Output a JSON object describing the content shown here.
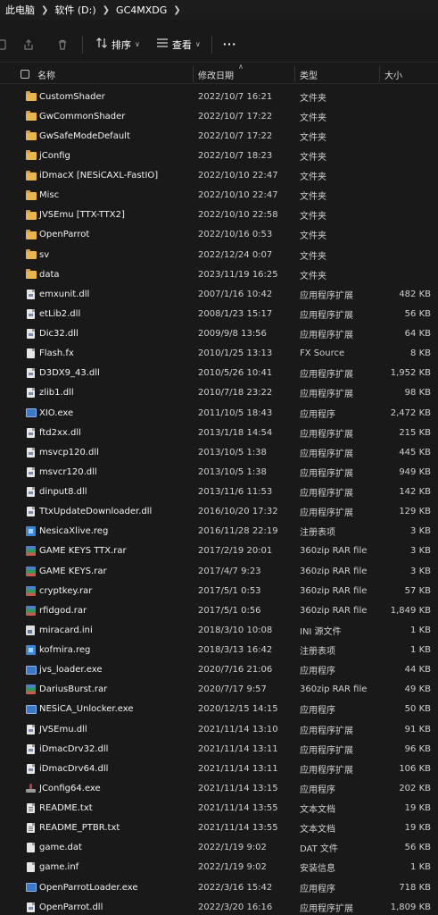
{
  "breadcrumb": [
    "此电脑",
    "软件 (D:)",
    "GC4MXDG"
  ],
  "toolbar": {
    "sort_label": "排序",
    "view_label": "查看",
    "more_label": "···"
  },
  "columns": {
    "name": "名称",
    "date": "修改日期",
    "type": "类型",
    "size": "大小"
  },
  "files": [
    {
      "icon": "folder",
      "name": "CustomShader",
      "date": "2022/10/7 16:21",
      "type": "文件夹",
      "size": ""
    },
    {
      "icon": "folder",
      "name": "GwCommonShader",
      "date": "2022/10/7 17:22",
      "type": "文件夹",
      "size": ""
    },
    {
      "icon": "folder",
      "name": "GwSafeModeDefault",
      "date": "2022/10/7 17:22",
      "type": "文件夹",
      "size": ""
    },
    {
      "icon": "folder",
      "name": "jConfig",
      "date": "2022/10/7 18:23",
      "type": "文件夹",
      "size": ""
    },
    {
      "icon": "folder",
      "name": "iDmacX [NESiCAXL-FastIO]",
      "date": "2022/10/10 22:47",
      "type": "文件夹",
      "size": ""
    },
    {
      "icon": "folder",
      "name": "Misc",
      "date": "2022/10/10 22:47",
      "type": "文件夹",
      "size": ""
    },
    {
      "icon": "folder",
      "name": "JVSEmu [TTX-TTX2]",
      "date": "2022/10/10 22:58",
      "type": "文件夹",
      "size": ""
    },
    {
      "icon": "folder",
      "name": "OpenParrot",
      "date": "2022/10/16 0:53",
      "type": "文件夹",
      "size": ""
    },
    {
      "icon": "folder",
      "name": "sv",
      "date": "2022/12/24 0:07",
      "type": "文件夹",
      "size": ""
    },
    {
      "icon": "folder",
      "name": "data",
      "date": "2023/11/19 16:25",
      "type": "文件夹",
      "size": ""
    },
    {
      "icon": "dll",
      "name": "emxunit.dll",
      "date": "2007/1/16 10:42",
      "type": "应用程序扩展",
      "size": "482 KB"
    },
    {
      "icon": "dll",
      "name": "etLib2.dll",
      "date": "2008/1/23 15:17",
      "type": "应用程序扩展",
      "size": "56 KB"
    },
    {
      "icon": "dll",
      "name": "Dic32.dll",
      "date": "2009/9/8 13:56",
      "type": "应用程序扩展",
      "size": "64 KB"
    },
    {
      "icon": "file",
      "name": "Flash.fx",
      "date": "2010/1/25 13:13",
      "type": "FX Source",
      "size": "8 KB"
    },
    {
      "icon": "dll",
      "name": "D3DX9_43.dll",
      "date": "2010/5/26 10:41",
      "type": "应用程序扩展",
      "size": "1,952 KB"
    },
    {
      "icon": "dll",
      "name": "zlib1.dll",
      "date": "2010/7/18 23:22",
      "type": "应用程序扩展",
      "size": "98 KB"
    },
    {
      "icon": "exe",
      "name": "XIO.exe",
      "date": "2011/10/5 18:43",
      "type": "应用程序",
      "size": "2,472 KB"
    },
    {
      "icon": "dll",
      "name": "ftd2xx.dll",
      "date": "2013/1/18 14:54",
      "type": "应用程序扩展",
      "size": "215 KB"
    },
    {
      "icon": "dll",
      "name": "msvcp120.dll",
      "date": "2013/10/5 1:38",
      "type": "应用程序扩展",
      "size": "445 KB"
    },
    {
      "icon": "dll",
      "name": "msvcr120.dll",
      "date": "2013/10/5 1:38",
      "type": "应用程序扩展",
      "size": "949 KB"
    },
    {
      "icon": "dll",
      "name": "dinput8.dll",
      "date": "2013/11/6 11:53",
      "type": "应用程序扩展",
      "size": "142 KB"
    },
    {
      "icon": "dll",
      "name": "TtxUpdateDownloader.dll",
      "date": "2016/10/20 17:32",
      "type": "应用程序扩展",
      "size": "129 KB"
    },
    {
      "icon": "reg",
      "name": "NesicaXlive.reg",
      "date": "2016/11/28 22:19",
      "type": "注册表项",
      "size": "3 KB"
    },
    {
      "icon": "rar",
      "name": "GAME KEYS TTX.rar",
      "date": "2017/2/19 20:01",
      "type": "360zip RAR file",
      "size": "3 KB"
    },
    {
      "icon": "rar",
      "name": "GAME KEYS.rar",
      "date": "2017/4/7 9:23",
      "type": "360zip RAR file",
      "size": "3 KB"
    },
    {
      "icon": "rar",
      "name": "cryptkey.rar",
      "date": "2017/5/1 0:53",
      "type": "360zip RAR file",
      "size": "57 KB"
    },
    {
      "icon": "rar",
      "name": "rfidgod.rar",
      "date": "2017/5/1 0:56",
      "type": "360zip RAR file",
      "size": "1,849 KB"
    },
    {
      "icon": "ini",
      "name": "miracard.ini",
      "date": "2018/3/10 10:08",
      "type": "INI 源文件",
      "size": "1 KB"
    },
    {
      "icon": "reg",
      "name": "kofmira.reg",
      "date": "2018/3/13 16:42",
      "type": "注册表项",
      "size": "1 KB"
    },
    {
      "icon": "exe",
      "name": "jvs_loader.exe",
      "date": "2020/7/16 21:06",
      "type": "应用程序",
      "size": "44 KB"
    },
    {
      "icon": "rar",
      "name": "DariusBurst.rar",
      "date": "2020/7/17 9:57",
      "type": "360zip RAR file",
      "size": "49 KB"
    },
    {
      "icon": "exe",
      "name": "NESiCA_Unlocker.exe",
      "date": "2020/12/15 14:15",
      "type": "应用程序",
      "size": "50 KB"
    },
    {
      "icon": "dll",
      "name": "JVSEmu.dll",
      "date": "2021/11/14 13:10",
      "type": "应用程序扩展",
      "size": "91 KB"
    },
    {
      "icon": "dll",
      "name": "iDmacDrv32.dll",
      "date": "2021/11/14 13:11",
      "type": "应用程序扩展",
      "size": "96 KB"
    },
    {
      "icon": "dll",
      "name": "iDmacDrv64.dll",
      "date": "2021/11/14 13:11",
      "type": "应用程序扩展",
      "size": "106 KB"
    },
    {
      "icon": "joystick",
      "name": "JConfig64.exe",
      "date": "2021/11/14 13:15",
      "type": "应用程序",
      "size": "202 KB"
    },
    {
      "icon": "txt",
      "name": "README.txt",
      "date": "2021/11/14 13:55",
      "type": "文本文档",
      "size": "19 KB"
    },
    {
      "icon": "txt",
      "name": "README_PTBR.txt",
      "date": "2021/11/14 13:55",
      "type": "文本文档",
      "size": "19 KB"
    },
    {
      "icon": "file",
      "name": "game.dat",
      "date": "2022/1/19 9:02",
      "type": "DAT 文件",
      "size": "56 KB"
    },
    {
      "icon": "file",
      "name": "game.inf",
      "date": "2022/1/19 9:02",
      "type": "安装信息",
      "size": "1 KB"
    },
    {
      "icon": "exe",
      "name": "OpenParrotLoader.exe",
      "date": "2022/3/16 15:42",
      "type": "应用程序",
      "size": "718 KB"
    },
    {
      "icon": "dll",
      "name": "OpenParrot.dll",
      "date": "2022/3/20 16:16",
      "type": "应用程序扩展",
      "size": "1,809 KB"
    }
  ]
}
